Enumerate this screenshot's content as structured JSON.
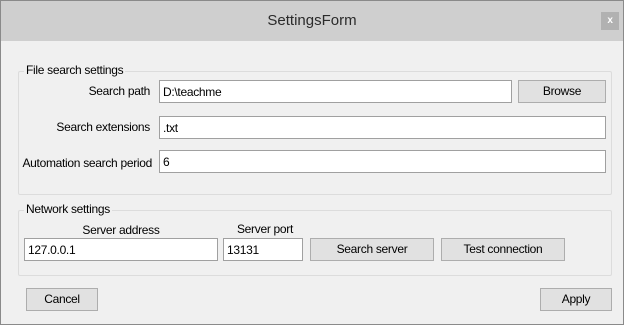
{
  "window": {
    "title": "SettingsForm",
    "close_label": "x"
  },
  "file_search": {
    "group_label": "File search settings",
    "search_path_label": "Search path",
    "search_path_value": "D:\\teachme",
    "browse_label": "Browse",
    "extensions_label": "Search extensions",
    "extensions_value": ".txt",
    "period_label": "Automation search period",
    "period_value": "6"
  },
  "network": {
    "group_label": "Network settings",
    "server_address_label": "Server address",
    "server_address_value": "127.0.0.1",
    "server_port_label": "Server port",
    "server_port_value": "13131",
    "search_server_label": "Search server",
    "test_connection_label": "Test connection"
  },
  "footer": {
    "cancel_label": "Cancel",
    "apply_label": "Apply"
  }
}
